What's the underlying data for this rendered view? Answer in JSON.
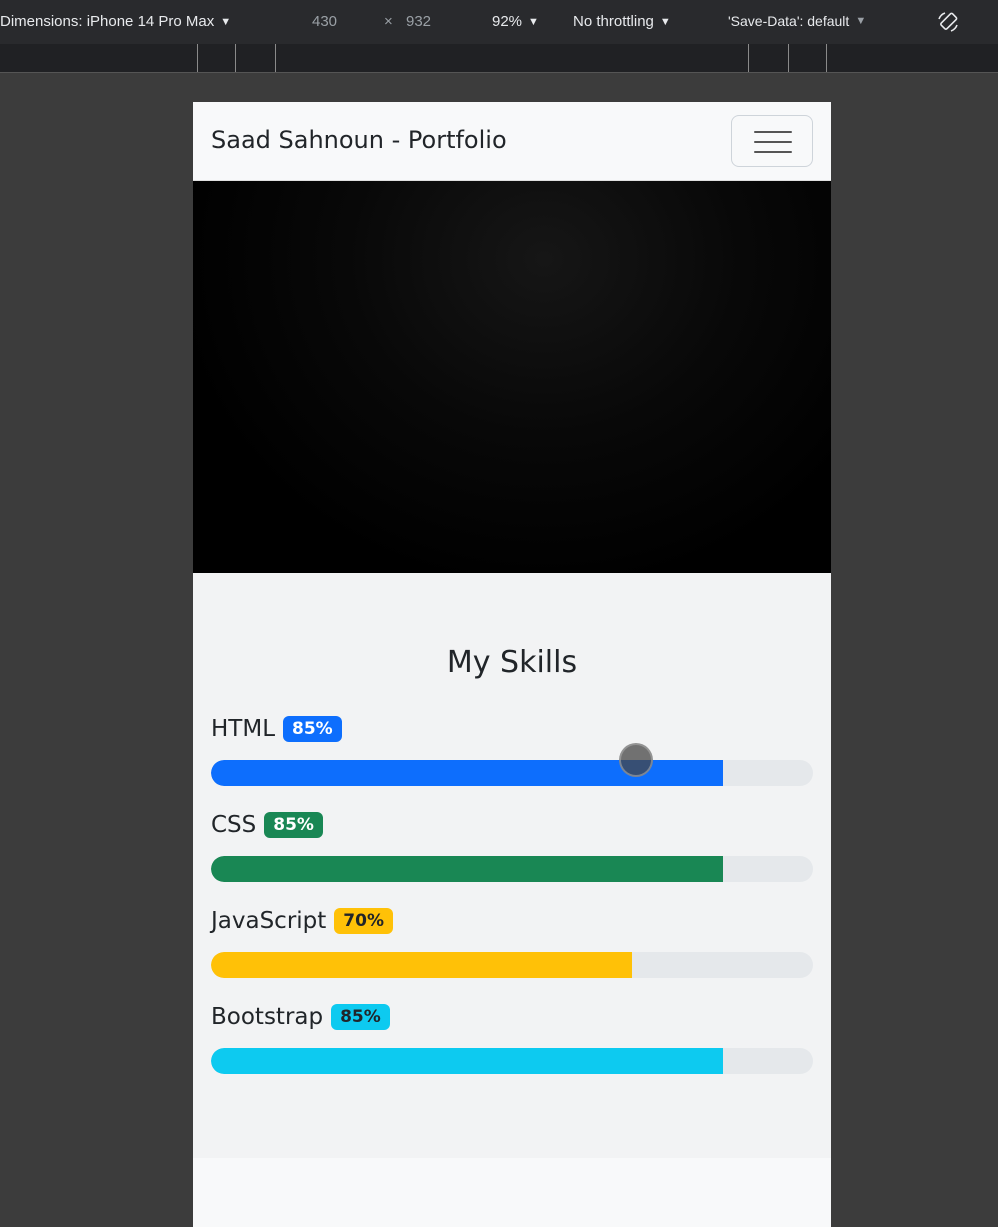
{
  "devtools": {
    "dimensions_label": "Dimensions: iPhone 14 Pro Max",
    "width": "430",
    "times": "×",
    "height": "932",
    "zoom": "92%",
    "throttling": "No throttling",
    "save_data": "'Save-Data': default",
    "rotate_icon": "rotate-icon"
  },
  "navbar": {
    "brand": "Saad Sahnoun - Portfolio",
    "toggler_icon": "hamburger-icon"
  },
  "skills": {
    "title": "My Skills",
    "items": [
      {
        "name": "HTML",
        "percent_label": "85%",
        "percent": 85,
        "color": "#0d6efd",
        "badge_text_color": "#ffffff"
      },
      {
        "name": "CSS",
        "percent_label": "85%",
        "percent": 85,
        "color": "#198754",
        "badge_text_color": "#ffffff"
      },
      {
        "name": "JavaScript",
        "percent_label": "70%",
        "percent": 70,
        "color": "#ffc107",
        "badge_text_color": "#212529"
      },
      {
        "name": "Bootstrap",
        "percent_label": "85%",
        "percent": 85,
        "color": "#0dcaf0",
        "badge_text_color": "#212529"
      }
    ]
  }
}
